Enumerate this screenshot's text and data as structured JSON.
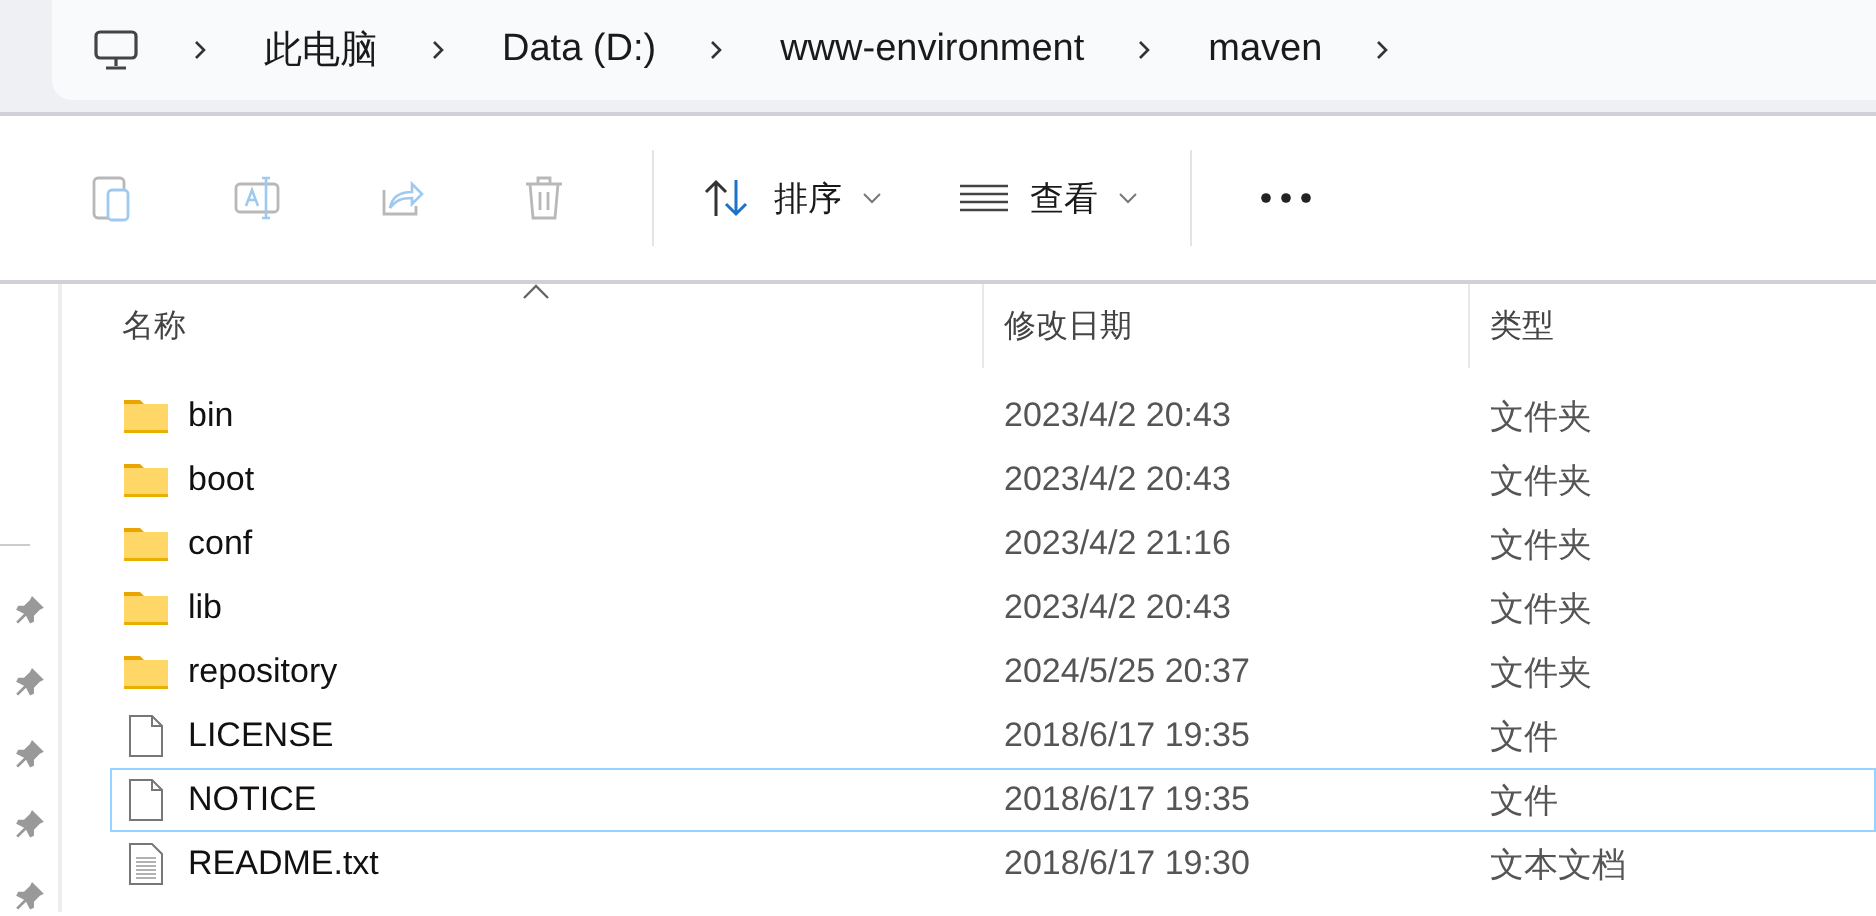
{
  "breadcrumb": {
    "items": [
      "此电脑",
      "Data (D:)",
      "www-environment",
      "maven"
    ]
  },
  "toolbar": {
    "actions": [
      {
        "kind": "paste",
        "disabled": true
      },
      {
        "kind": "rename",
        "disabled": true
      },
      {
        "kind": "share",
        "disabled": true
      },
      {
        "kind": "delete",
        "disabled": true
      }
    ],
    "menus": [
      {
        "kind": "sort",
        "label": "排序"
      },
      {
        "kind": "view",
        "label": "查看"
      }
    ]
  },
  "table": {
    "columns": [
      {
        "label": "名称",
        "sorted": true
      },
      {
        "label": "修改日期",
        "sorted": false
      },
      {
        "label": "类型",
        "sorted": false
      }
    ],
    "rows": [
      {
        "kind": "folder",
        "name": "bin",
        "modified": "2023/4/2 20:43",
        "type": "文件夹",
        "focused": false
      },
      {
        "kind": "folder",
        "name": "boot",
        "modified": "2023/4/2 20:43",
        "type": "文件夹",
        "focused": false
      },
      {
        "kind": "folder",
        "name": "conf",
        "modified": "2023/4/2 21:16",
        "type": "文件夹",
        "focused": false
      },
      {
        "kind": "folder",
        "name": "lib",
        "modified": "2023/4/2 20:43",
        "type": "文件夹",
        "focused": false
      },
      {
        "kind": "folder",
        "name": "repository",
        "modified": "2024/5/25 20:37",
        "type": "文件夹",
        "focused": false
      },
      {
        "kind": "file",
        "name": "LICENSE",
        "modified": "2018/6/17 19:35",
        "type": "文件",
        "focused": false
      },
      {
        "kind": "file",
        "name": "NOTICE",
        "modified": "2018/6/17 19:35",
        "type": "文件",
        "focused": true
      },
      {
        "kind": "text",
        "name": "README.txt",
        "modified": "2018/6/17 19:30",
        "type": "文本文档",
        "focused": false
      }
    ]
  }
}
